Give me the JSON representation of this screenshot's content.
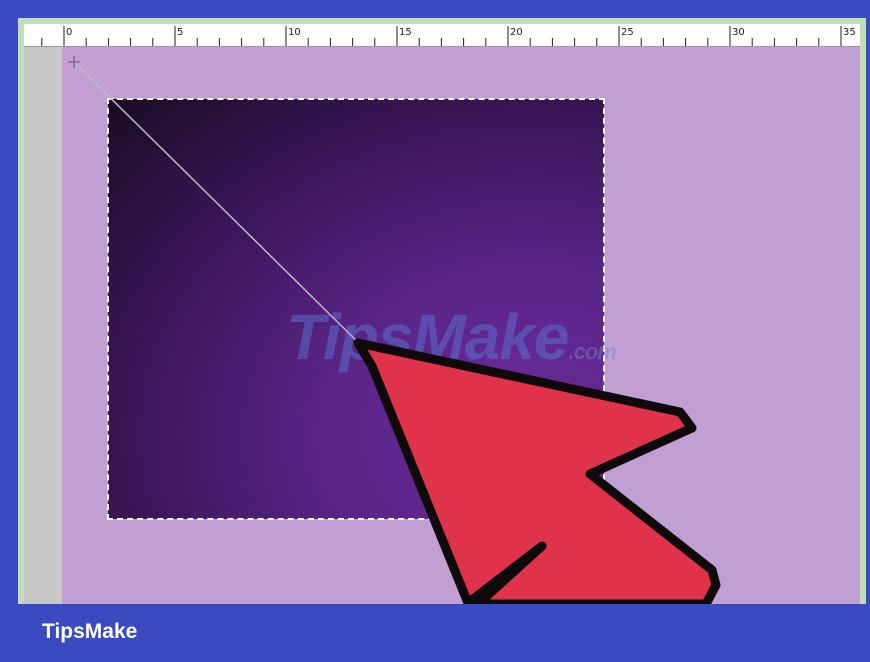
{
  "ruler": {
    "labels": [
      "0",
      "5",
      "10",
      "15",
      "20",
      "25",
      "30",
      "35"
    ]
  },
  "watermark": {
    "text": "TipsMake",
    "suffix": ".com"
  },
  "footer": {
    "brand": "TipsMake"
  },
  "colors": {
    "frame": "#3a4bc2",
    "canvas": "#c29fd2",
    "gradient_dark": "#1a0b22",
    "gradient_light": "#6b2b9b",
    "cursor_fill": "#e0324a"
  },
  "icons": {
    "cursor": "mouse-pointer-arrow-icon",
    "start_point": "crosshair-icon"
  }
}
